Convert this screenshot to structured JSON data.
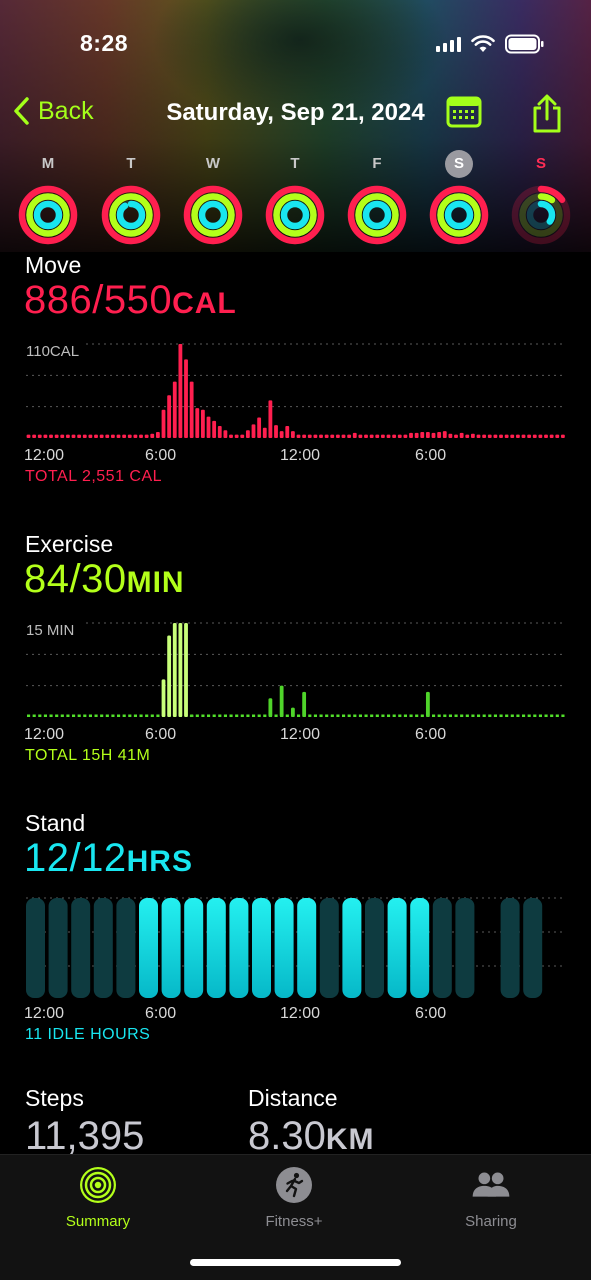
{
  "status_bar": {
    "time": "8:28"
  },
  "nav": {
    "back_label": "Back",
    "title": "Saturday, Sep 21, 2024"
  },
  "week": [
    {
      "letter": "M",
      "move": 1.0,
      "exercise": 1.0,
      "stand": 1.0,
      "selected": false,
      "today": false
    },
    {
      "letter": "T",
      "move": 1.0,
      "exercise": 1.0,
      "stand": 0.9,
      "selected": false,
      "today": false
    },
    {
      "letter": "W",
      "move": 1.0,
      "exercise": 1.0,
      "stand": 1.0,
      "selected": false,
      "today": false
    },
    {
      "letter": "T",
      "move": 1.0,
      "exercise": 1.0,
      "stand": 1.0,
      "selected": false,
      "today": false
    },
    {
      "letter": "F",
      "move": 1.0,
      "exercise": 1.0,
      "stand": 1.0,
      "selected": false,
      "today": false
    },
    {
      "letter": "S",
      "move": 1.0,
      "exercise": 1.0,
      "stand": 1.0,
      "selected": true,
      "today": false
    },
    {
      "letter": "S",
      "move": 0.15,
      "exercise": 0.1,
      "stand": 0.35,
      "selected": false,
      "today": true
    }
  ],
  "colors": {
    "move": "#ff1f4f",
    "exercise": "#b3ff1a",
    "stand": "#19e6f0",
    "accent": "#a4ff1a"
  },
  "move": {
    "label": "Move",
    "value": "886/550",
    "unit": "CAL",
    "total": "TOTAL 2,551 CAL"
  },
  "exercise": {
    "label": "Exercise",
    "value": "84/30",
    "unit": "MIN",
    "total": "TOTAL 15H 41M"
  },
  "stand": {
    "label": "Stand",
    "value": "12/12",
    "unit": "HRS",
    "total": "11 IDLE HOURS"
  },
  "steps": {
    "label": "Steps",
    "value": "11,395"
  },
  "distance": {
    "label": "Distance",
    "value": "8.30",
    "unit": "KM"
  },
  "tabs": [
    {
      "label": "Summary",
      "icon": "activity-rings-icon",
      "active": true
    },
    {
      "label": "Fitness+",
      "icon": "runner-icon",
      "active": false
    },
    {
      "label": "Sharing",
      "icon": "people-icon",
      "active": false
    }
  ],
  "chart_data": [
    {
      "type": "bar",
      "name": "move",
      "ymax_label": "110CAL",
      "ylim": [
        0,
        110
      ],
      "x_tick_labels": [
        "12:00",
        "6:00",
        "12:00",
        "6:00"
      ],
      "minutes_per_bar": 15,
      "values": [
        0.2,
        0.2,
        0.2,
        0.2,
        0.2,
        0.2,
        0.2,
        0.2,
        0.2,
        0.2,
        0.2,
        0.2,
        0.2,
        0.2,
        0.2,
        0.2,
        0.2,
        0.2,
        0.2,
        0.2,
        0.2,
        0.2,
        0.2,
        0.2,
        0.2,
        0.2,
        0.2,
        0.2,
        0.2,
        0.2,
        0.2,
        0.2,
        0.2,
        0.2,
        0.2,
        0.2,
        0.2,
        0.2,
        0.2,
        0.2,
        0.2,
        0.2,
        0.2,
        0.2,
        0.2,
        0.2,
        0.2,
        0.2,
        0.2,
        0.2,
        0.2,
        0.2,
        0.2,
        0.2,
        0.2,
        0.2,
        0.2,
        0.2,
        0.2,
        0.2,
        0.2,
        0.2,
        0.2,
        0.2,
        0.2,
        0.2,
        0.2,
        0.2,
        0.2,
        0.2,
        0.2,
        0.2,
        0.2,
        0.2,
        0.2,
        0.2,
        0.2,
        0.2,
        0.2,
        0.2,
        0.2,
        0.2,
        0.2,
        0.2,
        0.2,
        0.2,
        0.2,
        0.2,
        0.2,
        0.2,
        0.2,
        0.2,
        0.2,
        0.2,
        0.2,
        0.2,
        0.2,
        0.2,
        0.2,
        0.2,
        0.2,
        0.2,
        0.2,
        0.2,
        0.2,
        0.2,
        0.2,
        0.2,
        0.2,
        0.2,
        0.2,
        0.2,
        0.2,
        0.2,
        0.2,
        0.2,
        0.2,
        0.2,
        0.2,
        0.2,
        0.2,
        0.2,
        0.2,
        0.2,
        0.2,
        0.2,
        0.2,
        0.2,
        0.2,
        0.2,
        0.2,
        0.2,
        0.2,
        0.2,
        0.2,
        0.2,
        0.2,
        0.2,
        0.2,
        0.2,
        0.2,
        0.2,
        0.2,
        0.2,
        0.2,
        0.2,
        0.2,
        0.2,
        0.2,
        0.2,
        0.2,
        0.2,
        0.2,
        0.2,
        0.2,
        0.2,
        0.2,
        0.2,
        0.2,
        0.2,
        0.2,
        0.2,
        0.2,
        0.2,
        0.2,
        0.2,
        0.2,
        0.2,
        0.2,
        0.2,
        0.2,
        0.2,
        0.2,
        0.2,
        0.2,
        0.2,
        0.2,
        0.2,
        0.2,
        0.2,
        0.2,
        0.2,
        0.2,
        0.2,
        0.2,
        0.2,
        0.2,
        0.2,
        0.2,
        0.2,
        0.2,
        0.2,
        0.2,
        0.2,
        0.2,
        0.2,
        0.2,
        0.2,
        0.2,
        0.2,
        0.2,
        0.2,
        0.2,
        0.2,
        0.2,
        0.2,
        0.2,
        0.2,
        0.2,
        0.2,
        0.2,
        0.2,
        0.2,
        0.2,
        0.2,
        0.2,
        0.2,
        0.2,
        0.2,
        0.2,
        0.2,
        0.2,
        0.2,
        0.2,
        0.2,
        0.2,
        0.2,
        0.2,
        0.2,
        0.2,
        0.2,
        0.2,
        0.2,
        0.2,
        0.2,
        0.2,
        0.2,
        0.2,
        0.2,
        0.2,
        0.2,
        0.2,
        0.2,
        0.2,
        0.2,
        0.2,
        0.2,
        0.2,
        0.2,
        0.2,
        0.2,
        0.2,
        0.2,
        0.2,
        0.2,
        0.2
      ],
      "bars": [
        [
          0,
          4
        ],
        [
          1,
          4
        ],
        [
          2,
          4
        ],
        [
          3,
          4
        ],
        [
          4,
          4
        ],
        [
          5,
          4
        ],
        [
          6,
          4
        ],
        [
          7,
          4
        ],
        [
          8,
          4
        ],
        [
          9,
          4
        ],
        [
          10,
          4
        ],
        [
          11,
          4
        ],
        [
          12,
          4
        ],
        [
          13,
          4
        ],
        [
          14,
          4
        ],
        [
          15,
          4
        ],
        [
          16,
          4
        ],
        [
          17,
          4
        ],
        [
          18,
          4
        ],
        [
          19,
          4
        ],
        [
          20,
          4
        ],
        [
          21,
          4
        ],
        [
          22,
          5
        ],
        [
          23,
          7
        ],
        [
          24,
          33
        ],
        [
          25,
          50
        ],
        [
          26,
          66
        ],
        [
          27,
          110
        ],
        [
          28,
          92
        ],
        [
          29,
          66
        ],
        [
          30,
          35
        ],
        [
          31,
          33
        ],
        [
          32,
          25
        ],
        [
          33,
          20
        ],
        [
          34,
          14
        ],
        [
          35,
          9
        ],
        [
          36,
          4
        ],
        [
          37,
          4
        ],
        [
          38,
          4
        ],
        [
          39,
          9
        ],
        [
          40,
          16
        ],
        [
          41,
          24
        ],
        [
          42,
          12
        ],
        [
          43,
          44
        ],
        [
          44,
          15
        ],
        [
          45,
          8
        ],
        [
          46,
          14
        ],
        [
          47,
          8
        ],
        [
          48,
          4
        ],
        [
          49,
          4
        ],
        [
          50,
          4
        ],
        [
          51,
          4
        ],
        [
          52,
          4
        ],
        [
          53,
          4
        ],
        [
          54,
          4
        ],
        [
          55,
          4
        ],
        [
          56,
          4
        ],
        [
          57,
          4
        ],
        [
          58,
          6
        ],
        [
          59,
          4
        ],
        [
          60,
          4
        ],
        [
          61,
          4
        ],
        [
          62,
          4
        ],
        [
          63,
          4
        ],
        [
          64,
          4
        ],
        [
          65,
          4
        ],
        [
          66,
          4
        ],
        [
          67,
          4
        ],
        [
          68,
          6
        ],
        [
          69,
          6
        ],
        [
          70,
          7
        ],
        [
          71,
          7
        ],
        [
          72,
          6
        ],
        [
          73,
          7
        ],
        [
          74,
          8
        ],
        [
          75,
          5
        ],
        [
          76,
          4
        ],
        [
          77,
          6
        ],
        [
          78,
          4
        ],
        [
          79,
          5
        ],
        [
          80,
          4
        ],
        [
          81,
          4
        ],
        [
          82,
          4
        ],
        [
          83,
          4
        ],
        [
          84,
          4
        ],
        [
          85,
          4
        ],
        [
          86,
          4
        ],
        [
          87,
          4
        ],
        [
          88,
          4
        ],
        [
          89,
          4
        ],
        [
          90,
          4
        ],
        [
          91,
          4
        ],
        [
          92,
          4
        ],
        [
          93,
          4
        ],
        [
          94,
          4
        ],
        [
          95,
          4
        ]
      ]
    },
    {
      "type": "bar",
      "name": "exercise",
      "ymax_label": "15 MIN",
      "ylim": [
        0,
        15
      ],
      "x_tick_labels": [
        "12:00",
        "6:00",
        "12:00",
        "6:00"
      ],
      "bars": [
        [
          24,
          6
        ],
        [
          25,
          13
        ],
        [
          26,
          15
        ],
        [
          27,
          15
        ],
        [
          28,
          15
        ],
        [
          29,
          0.3
        ],
        [
          43,
          3
        ],
        [
          45,
          5
        ],
        [
          47,
          1.5
        ],
        [
          49,
          4
        ],
        [
          71,
          4
        ]
      ]
    },
    {
      "type": "bar",
      "name": "stand",
      "x_tick_labels": [
        "12:00",
        "6:00",
        "12:00",
        "6:00"
      ],
      "hours": [
        0,
        0,
        0,
        0,
        0,
        1,
        1,
        1,
        1,
        1,
        1,
        1,
        1,
        0,
        1,
        0,
        1,
        1,
        0,
        0,
        null,
        0,
        0
      ],
      "stood_hours": 12
    }
  ]
}
